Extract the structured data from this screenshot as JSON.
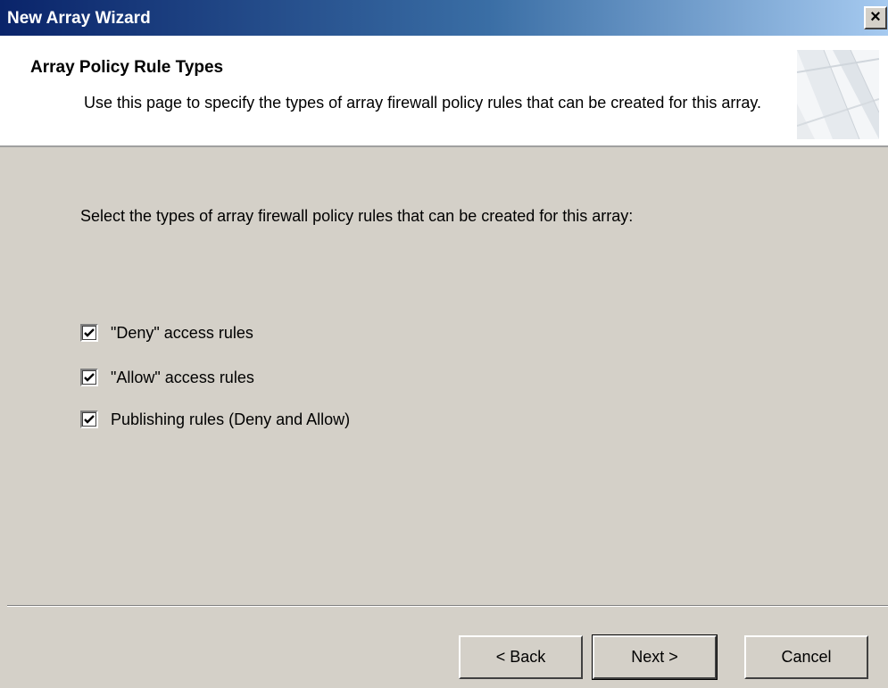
{
  "window": {
    "title": "New Array Wizard",
    "close_symbol": "×"
  },
  "header": {
    "title": "Array Policy Rule Types",
    "description": "Use this page to specify the types of array firewall policy rules that can be created for this array.",
    "graphic_icon": "wizard-banner-graphic"
  },
  "content": {
    "instruction": "Select the types of array firewall policy rules that can be created for this array:",
    "options": [
      {
        "label": "\"Deny\" access rules",
        "checked": true
      },
      {
        "label": "\"Allow\" access rules",
        "checked": true
      },
      {
        "label": "Publishing rules (Deny and Allow)",
        "checked": true
      }
    ]
  },
  "buttons": {
    "back": "< Back",
    "next": "Next >",
    "cancel": "Cancel"
  },
  "colors": {
    "title_bar_start": "#0a246a",
    "title_bar_end": "#a6caf0",
    "dialog_face": "#d4d0c8",
    "header_background": "#ffffff"
  }
}
